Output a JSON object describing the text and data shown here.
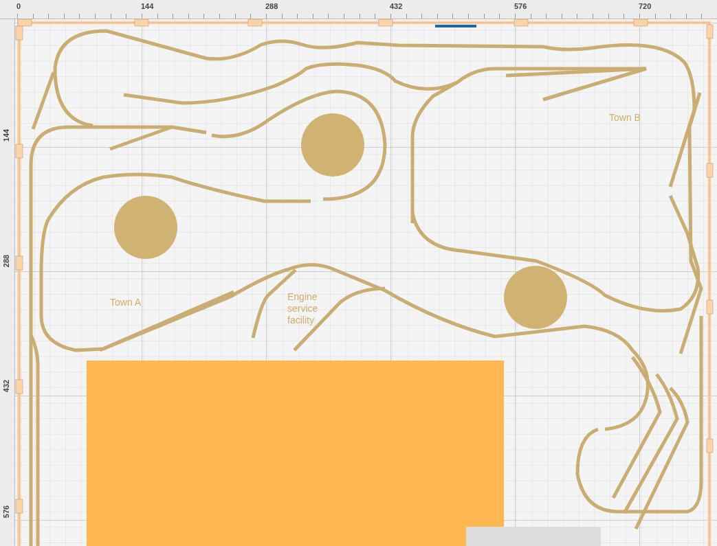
{
  "ruler_top": {
    "labels": [
      "0",
      "144",
      "288",
      "432",
      "576",
      "720"
    ]
  },
  "ruler_left": {
    "labels": [
      "144",
      "288",
      "432",
      "576"
    ]
  },
  "canvas": {
    "labels": [
      {
        "text": "Town B"
      },
      {
        "text": "Town A"
      },
      {
        "text": "Engine service facility"
      }
    ]
  }
}
